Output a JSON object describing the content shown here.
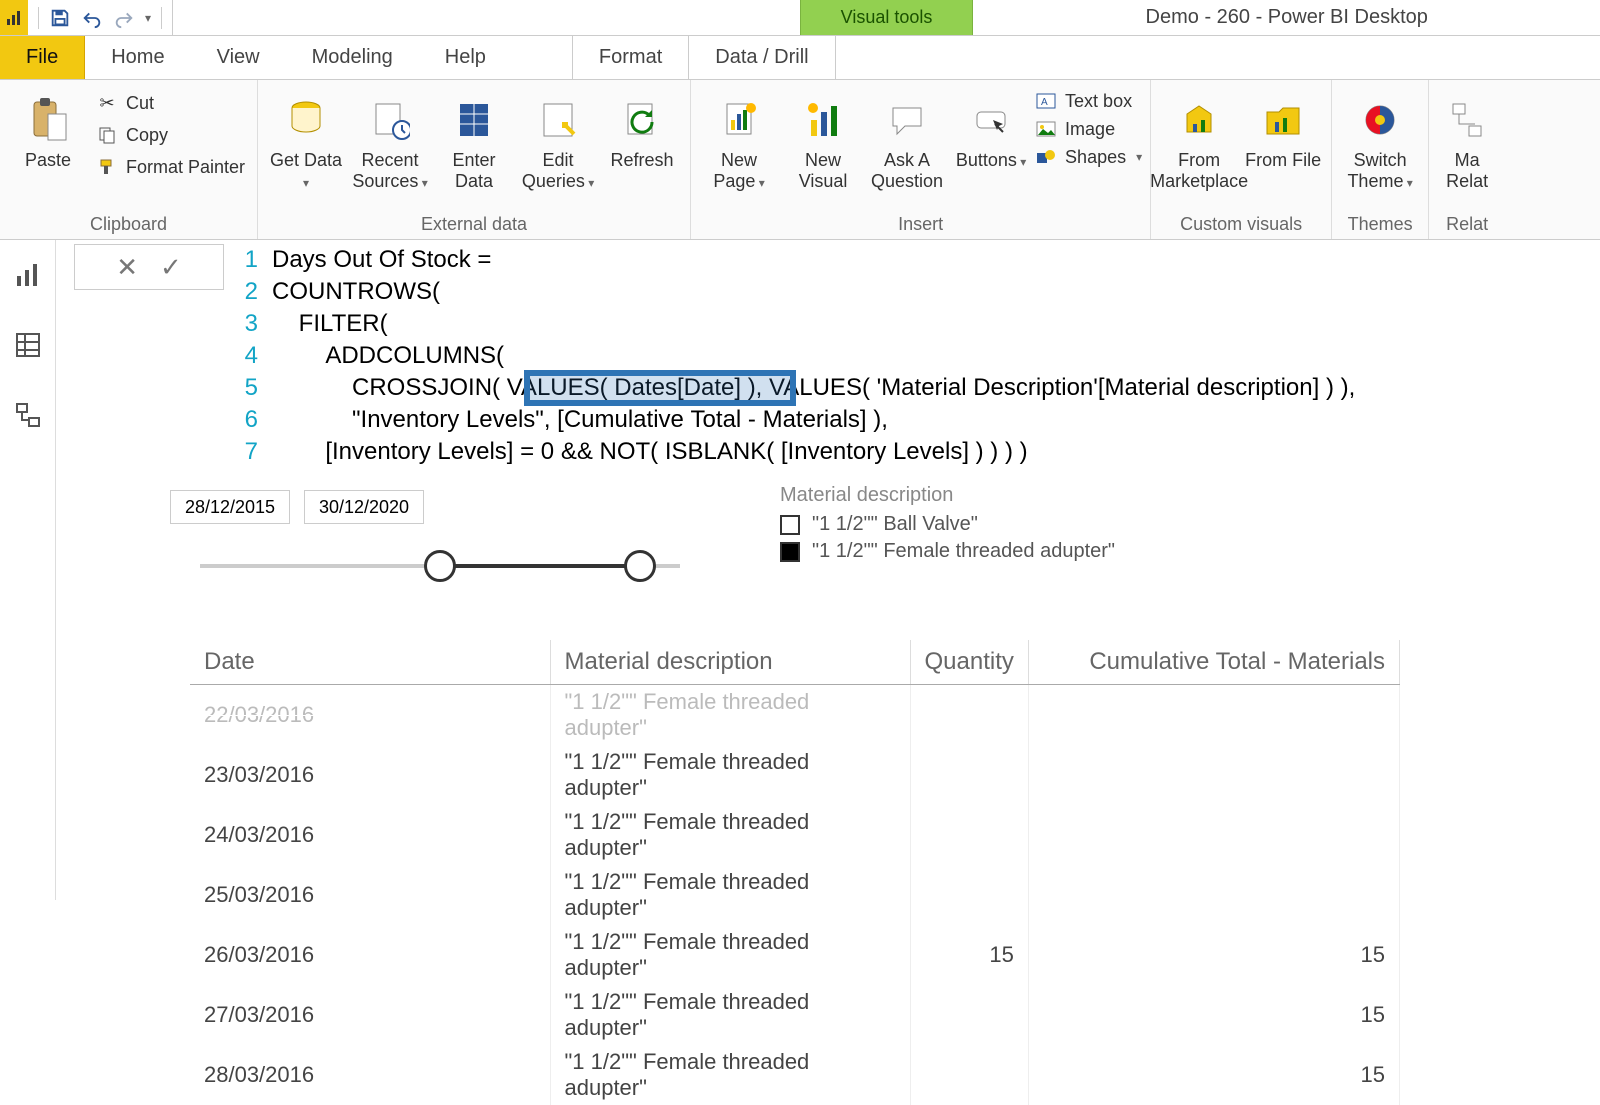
{
  "app": {
    "contextual_tab": "Visual tools",
    "title": "Demo - 260 - Power BI Desktop"
  },
  "tabs": {
    "file": "File",
    "home": "Home",
    "view": "View",
    "modeling": "Modeling",
    "help": "Help",
    "format": "Format",
    "datadrill": "Data / Drill"
  },
  "ribbon": {
    "clipboard": {
      "paste": "Paste",
      "cut": "Cut",
      "copy": "Copy",
      "format_painter": "Format Painter",
      "group": "Clipboard"
    },
    "external": {
      "get_data": "Get\nData",
      "recent_sources": "Recent\nSources",
      "enter_data": "Enter\nData",
      "edit_queries": "Edit\nQueries",
      "refresh": "Refresh",
      "group": "External data"
    },
    "insert": {
      "new_page": "New\nPage",
      "new_visual": "New\nVisual",
      "ask": "Ask A\nQuestion",
      "buttons": "Buttons",
      "textbox": "Text box",
      "image": "Image",
      "shapes": "Shapes",
      "group": "Insert"
    },
    "custom": {
      "marketplace": "From\nMarketplace",
      "file": "From\nFile",
      "group": "Custom visuals"
    },
    "themes": {
      "switch": "Switch\nTheme",
      "group": "Themes"
    },
    "relat": {
      "manage": "Ma\nRelat",
      "group": "Relat"
    }
  },
  "formula": {
    "lines": [
      "Days Out Of Stock =",
      "COUNTROWS(",
      "    FILTER(",
      "        ADDCOLUMNS(",
      "            CROSSJOIN( VALUES( Dates[Date] ), VALUES( 'Material Description'[Material description] ) ),",
      "            \"Inventory Levels\", [Cumulative Total - Materials] ),",
      "        [Inventory Levels] = 0 && NOT( ISBLANK( [Inventory Levels] ) ) ) )"
    ],
    "highlight_text": "VALUES( Dates[Date] )"
  },
  "slicer": {
    "start": "28/12/2015",
    "end": "30/12/2020"
  },
  "legend": {
    "header": "Material description",
    "item1": "\"1 1/2\"\" Ball Valve\"",
    "item2": "\"1 1/2\"\" Female threaded adupter\""
  },
  "table": {
    "headers": {
      "date": "Date",
      "desc": "Material description",
      "qty": "Quantity",
      "cum": "Cumulative Total - Materials"
    },
    "rows": [
      {
        "date": "22/03/2016",
        "desc": "\"1 1/2\"\" Female threaded adupter\"",
        "qty": "",
        "cum": "",
        "cut": true
      },
      {
        "date": "23/03/2016",
        "desc": "\"1 1/2\"\" Female threaded adupter\"",
        "qty": "",
        "cum": ""
      },
      {
        "date": "24/03/2016",
        "desc": "\"1 1/2\"\" Female threaded adupter\"",
        "qty": "",
        "cum": ""
      },
      {
        "date": "25/03/2016",
        "desc": "\"1 1/2\"\" Female threaded adupter\"",
        "qty": "",
        "cum": ""
      },
      {
        "date": "26/03/2016",
        "desc": "\"1 1/2\"\" Female threaded adupter\"",
        "qty": "15",
        "cum": "15"
      },
      {
        "date": "27/03/2016",
        "desc": "\"1 1/2\"\" Female threaded adupter\"",
        "qty": "",
        "cum": "15"
      },
      {
        "date": "28/03/2016",
        "desc": "\"1 1/2\"\" Female threaded adupter\"",
        "qty": "",
        "cum": "15"
      }
    ]
  }
}
